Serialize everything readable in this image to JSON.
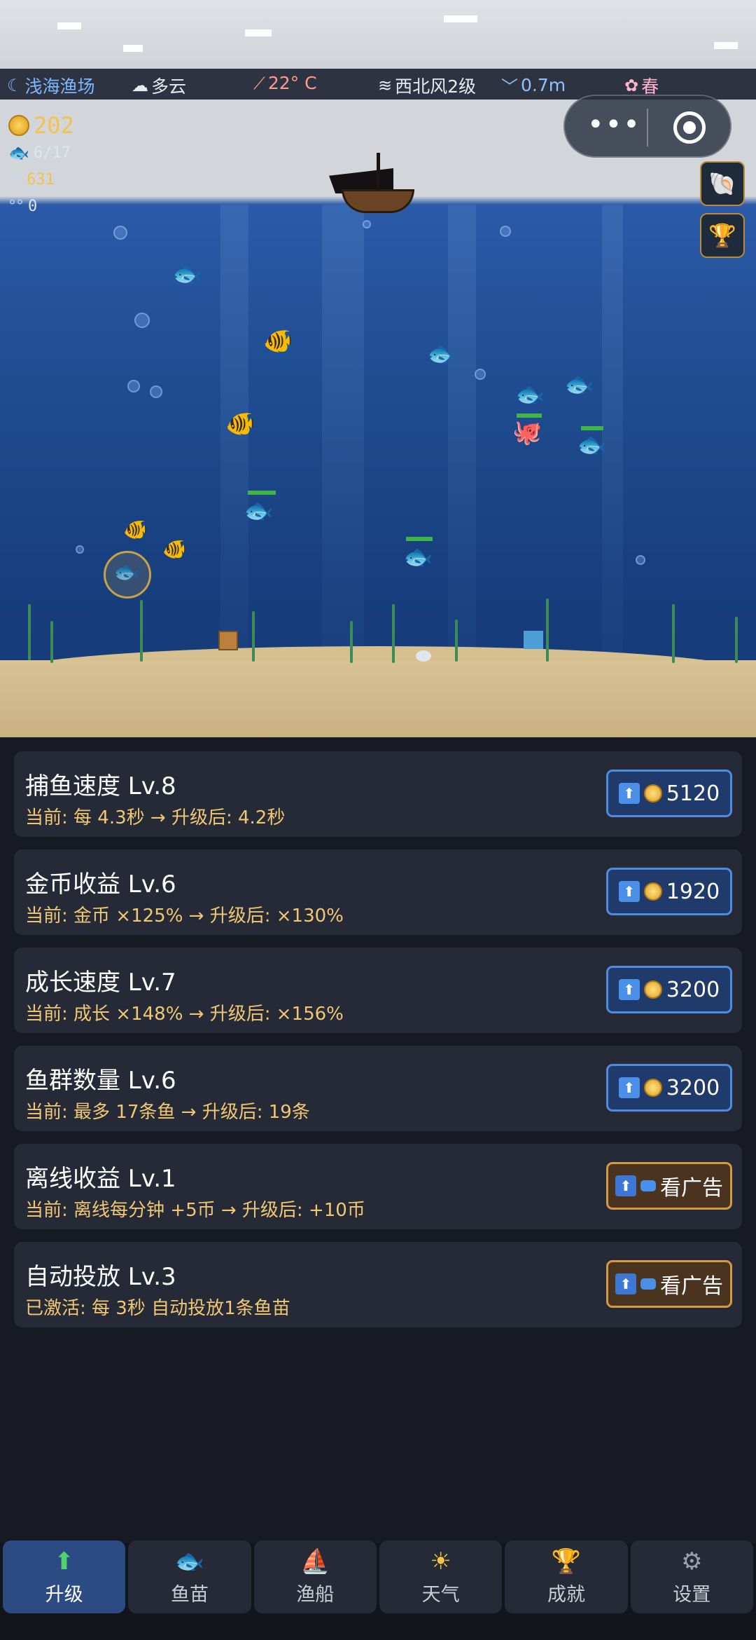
{
  "status_bar": {
    "location": "浅海渔场",
    "weather": "多云",
    "temperature": "22° C",
    "wind": "西北风2级",
    "wave": "0.7m",
    "season": "春"
  },
  "hud": {
    "coins": "202",
    "fish_count": "6/17",
    "catch_count": "631",
    "bubbles": "0"
  },
  "icons": {
    "location": "moon-icon",
    "weather": "cloud-icon",
    "temperature": "thermometer-icon",
    "wind": "wind-icon",
    "wave": "wave-icon",
    "season": "flower-icon",
    "coin": "coin-icon",
    "fish": "fish-icon",
    "hook": "hook-icon",
    "bubble": "bubble-icon",
    "more": "more-dots-icon",
    "close": "target-icon",
    "shell": "shell-icon",
    "trophy": "trophy-icon"
  },
  "upgrades": [
    {
      "title": "捕鱼速度 Lv.8",
      "desc": "当前: 每 4.3秒 → 升级后: 4.2秒",
      "button": "5120",
      "type": "coin"
    },
    {
      "title": "金币收益 Lv.6",
      "desc": "当前: 金币 ×125% → 升级后: ×130%",
      "button": "1920",
      "type": "coin"
    },
    {
      "title": "成长速度 Lv.7",
      "desc": "当前: 成长 ×148% → 升级后: ×156%",
      "button": "3200",
      "type": "coin"
    },
    {
      "title": "鱼群数量 Lv.6",
      "desc": "当前: 最多 17条鱼 → 升级后: 19条",
      "button": "3200",
      "type": "coin"
    },
    {
      "title": "离线收益 Lv.1",
      "desc": "当前: 离线每分钟 +5币 → 升级后: +10币",
      "button": "看广告",
      "type": "ad"
    },
    {
      "title": "自动投放 Lv.3",
      "desc": "已激活: 每 3秒 自动投放1条鱼苗",
      "button": "看广告",
      "type": "ad"
    }
  ],
  "nav": [
    {
      "label": "升级",
      "icon": "up-arrow-icon",
      "active": true
    },
    {
      "label": "鱼苗",
      "icon": "fish-icon",
      "active": false
    },
    {
      "label": "渔船",
      "icon": "boat-icon",
      "active": false
    },
    {
      "label": "天气",
      "icon": "sun-icon",
      "active": false
    },
    {
      "label": "成就",
      "icon": "trophy-icon",
      "active": false
    },
    {
      "label": "设置",
      "icon": "gear-icon",
      "active": false
    }
  ],
  "colors": {
    "accent_blue": "#4f8ce0",
    "accent_gold": "#d49a44",
    "desc_text": "#f0c874",
    "active_nav": "#2c4b83"
  }
}
